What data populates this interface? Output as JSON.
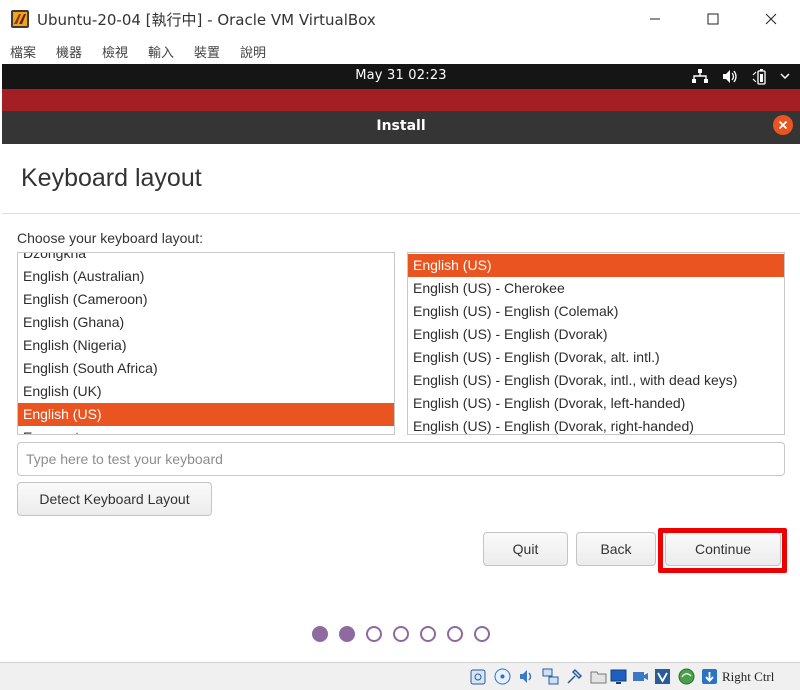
{
  "window": {
    "title": "Ubuntu-20-04 [執行中] - Oracle VM VirtualBox"
  },
  "menubar": {
    "items": [
      "檔案",
      "機器",
      "檢視",
      "輸入",
      "裝置",
      "說明"
    ]
  },
  "topbar": {
    "clock": "May 31  02:23",
    "tray_icons": [
      "network-icon",
      "volume-icon",
      "battery-icon",
      "chevron-down-icon"
    ]
  },
  "dialog": {
    "title": "Install",
    "page_title": "Keyboard layout",
    "prompt": "Choose your keyboard layout:"
  },
  "layouts": {
    "items": [
      "Dzongkha",
      "English (Australian)",
      "English (Cameroon)",
      "English (Ghana)",
      "English (Nigeria)",
      "English (South Africa)",
      "English (UK)",
      "English (US)",
      "Esperanto"
    ],
    "selected": "English (US)"
  },
  "variants": {
    "items": [
      "English (US)",
      "English (US) - Cherokee",
      "English (US) - English (Colemak)",
      "English (US) - English (Dvorak)",
      "English (US) - English (Dvorak, alt. intl.)",
      "English (US) - English (Dvorak, intl., with dead keys)",
      "English (US) - English (Dvorak, left-handed)",
      "English (US) - English (Dvorak, right-handed)"
    ],
    "selected": "English (US)"
  },
  "test_input": {
    "placeholder": "Type here to test your keyboard",
    "value": ""
  },
  "buttons": {
    "detect": "Detect Keyboard Layout",
    "quit": "Quit",
    "back": "Back",
    "continue": "Continue"
  },
  "progress": {
    "total_steps": 7,
    "completed_steps": 2
  },
  "statusbar": {
    "host_key": "Right Ctrl"
  },
  "colors": {
    "accent": "#e95420",
    "header": "#353535",
    "topbar": "#151515",
    "wallpaper": "#a31f24",
    "progress_dot": "#8f6aa0",
    "highlight": "#ee0000"
  }
}
